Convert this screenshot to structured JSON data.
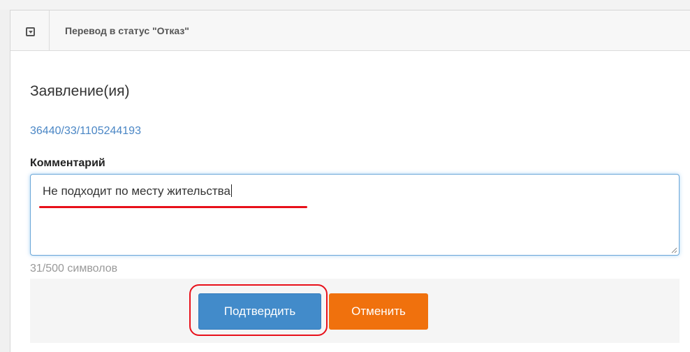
{
  "panel": {
    "title": "Перевод в статус \"Отказ\"",
    "collapse_icon": "collapse-toggle-icon"
  },
  "application": {
    "heading": "Заявление(ия)",
    "number": "36440/33/1105244193"
  },
  "comment": {
    "label": "Комментарий",
    "value": "Не подходит по месту жительства",
    "counter": "31/500 символов"
  },
  "actions": {
    "confirm_label": "Подтвердить",
    "cancel_label": "Отменить"
  },
  "colors": {
    "link": "#4a86c5",
    "confirm_button": "#428bca",
    "cancel_button": "#f0710d",
    "annotation": "#e8101a"
  }
}
